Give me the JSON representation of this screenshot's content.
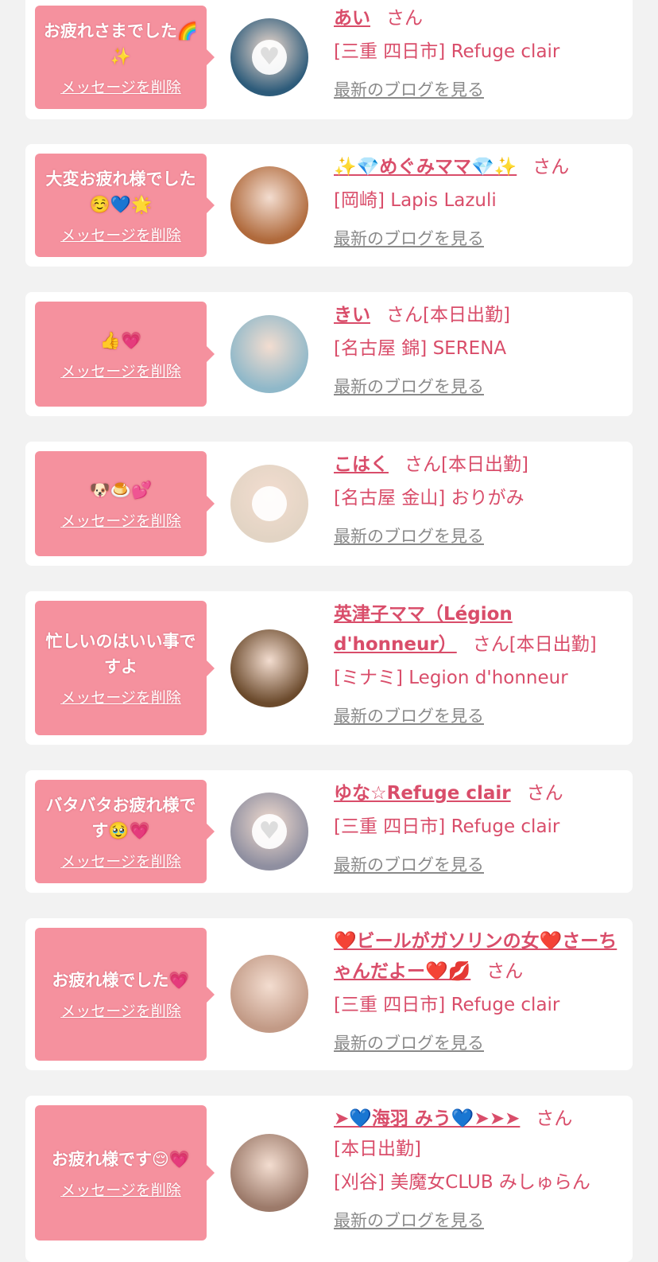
{
  "san_label": "さん",
  "delete_label": "メッセージを削除",
  "blog_label": "最新のブログを見る",
  "cards": [
    {
      "message": "お疲れさまでした🌈✨",
      "name": "あい",
      "badge": "",
      "shop": "[三重 四日市] Refuge clair"
    },
    {
      "message": "大変お疲れ様でした☺️💙🌟",
      "name": "✨💎めぐみママ💎✨",
      "badge": "",
      "shop": "[岡崎] Lapis Lazuli"
    },
    {
      "message": "👍💗",
      "name": "きい",
      "badge": "[本日出勤]",
      "shop": "[名古屋 錦] SERENA"
    },
    {
      "message": "🐶🍮💕",
      "name": "こはく",
      "badge": "[本日出勤]",
      "shop": "[名古屋 金山] おりがみ"
    },
    {
      "message": "忙しいのはいい事ですよ",
      "name": "英津子ママ（Légion d'honneur）",
      "badge": "[本日出勤]",
      "shop": "[ミナミ] Legion d'honneur"
    },
    {
      "message": "バタバタお疲れ様です🥹💗",
      "name": "ゆな☆Refuge clair",
      "badge": "",
      "shop": "[三重 四日市] Refuge clair"
    },
    {
      "message": "お疲れ様でした💗",
      "name": "❤️ビールがガソリンの女❤️さーちゃんだよー❤️💋",
      "badge": "",
      "shop": "[三重 四日市] Refuge clair"
    },
    {
      "message": "お疲れ様です😌💗",
      "name": "➤💙海羽 みう💙➤➤➤",
      "badge": "[本日出勤]",
      "shop": "[刈谷] 美魔女CLUB みしゅらん"
    }
  ],
  "avatars": [
    {
      "bg": "#2d5b7a",
      "masked": true
    },
    {
      "bg": "#b06a3c",
      "masked": false
    },
    {
      "bg": "#8fb8c9",
      "masked": false
    },
    {
      "bg": "#e2d4c4",
      "masked": true
    },
    {
      "bg": "#6b4a2c",
      "masked": false
    },
    {
      "bg": "#8f8fa0",
      "masked": true
    },
    {
      "bg": "#c29a86",
      "masked": false
    },
    {
      "bg": "#9c7a6a",
      "masked": false
    }
  ],
  "colors": {
    "accent": "#f5919e",
    "name": "#d94d6a",
    "link_gray": "#8a8a8a"
  }
}
